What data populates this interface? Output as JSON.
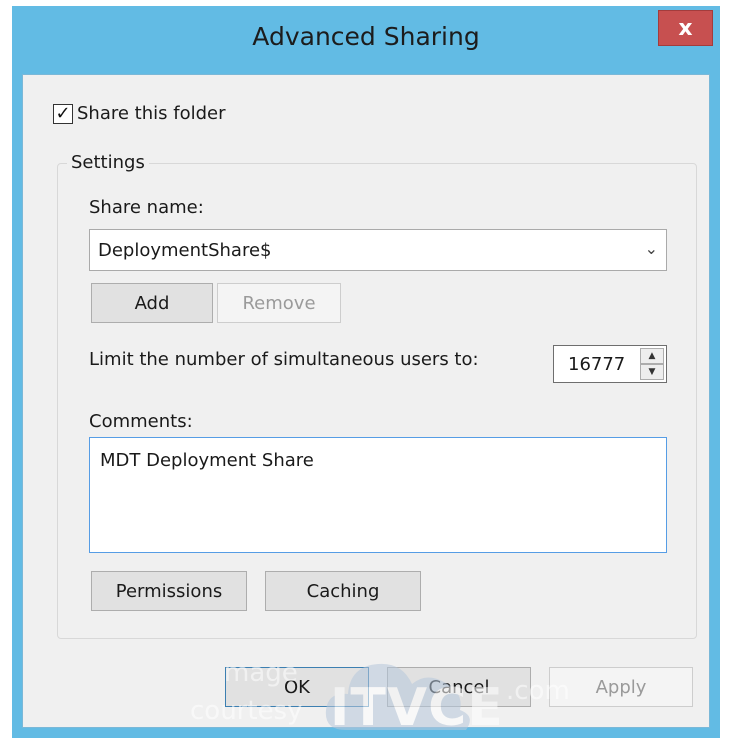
{
  "window": {
    "title": "Advanced Sharing",
    "close_label": "x"
  },
  "share_checkbox": {
    "label": "Share this folder",
    "checked": true,
    "check_glyph": "✓"
  },
  "settings": {
    "group_title": "Settings",
    "share_name_label": "Share name:",
    "share_name_value": "DeploymentShare$",
    "dropdown_glyph": "⌄",
    "add_label": "Add",
    "remove_label": "Remove",
    "limit_label": "Limit the number of simultaneous users to:",
    "limit_value": "16777",
    "spin_up_glyph": "▲",
    "spin_down_glyph": "▼",
    "comments_label": "Comments:",
    "comments_value": "MDT Deployment Share",
    "permissions_label": "Permissions",
    "caching_label": "Caching"
  },
  "footer": {
    "ok_label": "OK",
    "cancel_label": "Cancel",
    "apply_label": "Apply"
  },
  "watermark": {
    "line1": "mage",
    "line2": "courtesy",
    "brand": "ITVCE",
    "suffix": ".com"
  },
  "colors": {
    "title_bar": "#62bbe4",
    "close_button": "#c75050",
    "dialog_background": "#f0f0f0",
    "focus_border": "#569de5"
  }
}
